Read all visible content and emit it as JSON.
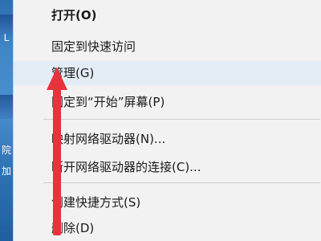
{
  "desktop": {
    "strip_texts": [
      "L",
      "院",
      "加"
    ]
  },
  "menu": {
    "items": [
      {
        "label": "打开(O)"
      },
      {
        "label": "固定到快速访问"
      },
      {
        "label": "管理(G)"
      },
      {
        "label": "固定到“开始”屏幕(P)"
      },
      {
        "label": "映射网络驱动器(N)..."
      },
      {
        "label": "断开网络驱动器的连接(C)..."
      },
      {
        "label": "创建快捷方式(S)"
      },
      {
        "label": "删除(D)"
      }
    ]
  },
  "annotation": {
    "arrow_color": "#e8323c",
    "arrow_direction": "up",
    "points_to": "管理(G)"
  }
}
